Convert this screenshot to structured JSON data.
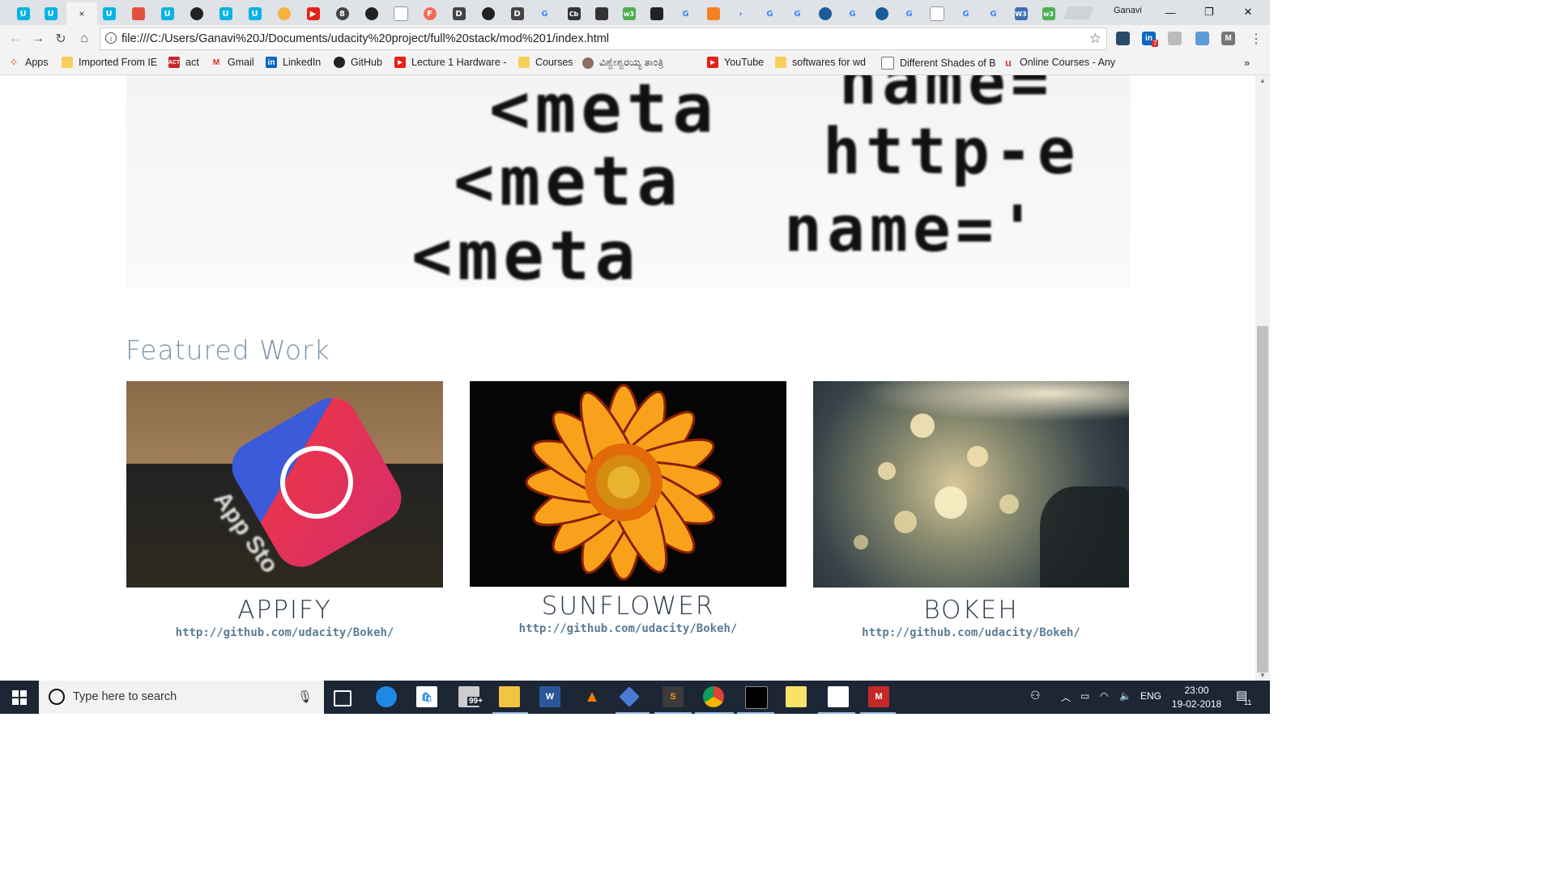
{
  "browser": {
    "profile_name": "Ganavi",
    "url": "file:///C:/Users/Ganavi%20J/Documents/udacity%20project/full%20stack/mod%201/index.html",
    "tab_close_glyph": "×",
    "extension_badge": "7"
  },
  "bookmarks": [
    {
      "label": "Apps",
      "icon": "apps-grid-icon"
    },
    {
      "label": "Imported From IE",
      "icon": "folder-icon"
    },
    {
      "label": "act",
      "icon": "act-icon"
    },
    {
      "label": "Gmail",
      "icon": "gmail-icon"
    },
    {
      "label": "LinkedIn",
      "icon": "linkedin-icon"
    },
    {
      "label": "GitHub",
      "icon": "github-icon"
    },
    {
      "label": "Lecture 1 Hardware -",
      "icon": "youtube-icon"
    },
    {
      "label": "Courses",
      "icon": "folder-icon"
    },
    {
      "label": "ವಿಶ್ವೇಶ್ವರಯ್ಯ ತಾಂತ್ರಿ",
      "icon": "university-icon"
    },
    {
      "label": "YouTube",
      "icon": "youtube-icon"
    },
    {
      "label": "softwares  for wd",
      "icon": "folder-icon"
    },
    {
      "label": "Different Shades of B",
      "icon": "page-icon"
    },
    {
      "label": "Online Courses - Any",
      "icon": "udemy-icon"
    }
  ],
  "hero": {
    "lines": [
      "<meta",
      "<meta",
      "<meta"
    ],
    "right_lines": [
      "name=",
      "http-e",
      "name='"
    ]
  },
  "page": {
    "section_title": "Featured Work",
    "cards": [
      {
        "title": "APPIFY",
        "link": "http://github.com/udacity/Bokeh/",
        "image": "app-store-icon-photo"
      },
      {
        "title": "SUNFLOWER",
        "link": "http://github.com/udacity/Bokeh/",
        "image": "sunflower-photo"
      },
      {
        "title": "BOKEH",
        "link": "http://github.com/udacity/Bokeh/",
        "image": "bokeh-lights-photo"
      }
    ]
  },
  "taskbar": {
    "search_placeholder": "Type here to search",
    "mail_badge": "99+",
    "language": "ENG",
    "time": "23:00",
    "date": "19-02-2018",
    "notification_count": "11"
  },
  "colors": {
    "section_title": "#7d93a8",
    "card_title": "#2b3a4a",
    "card_link": "#5a7d96",
    "taskbar": "#1c2635"
  }
}
